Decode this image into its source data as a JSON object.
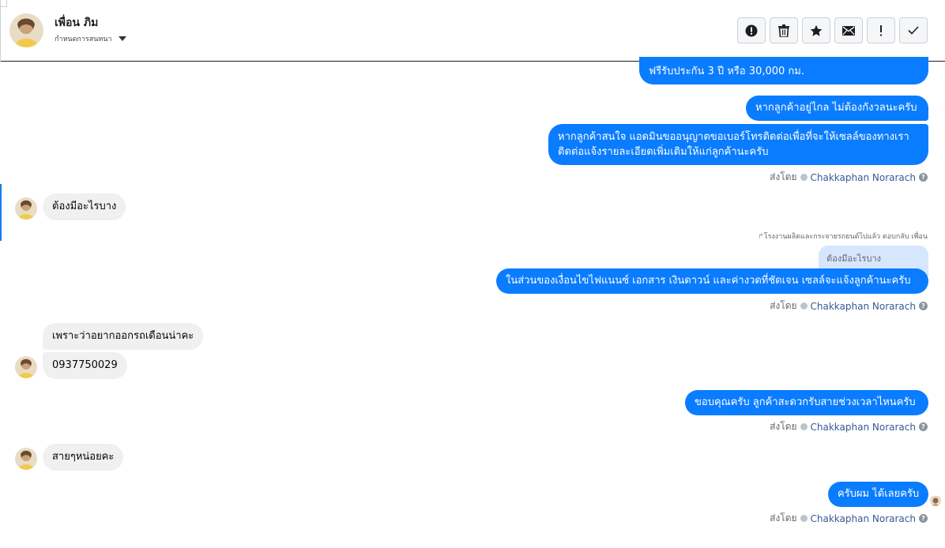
{
  "header": {
    "contact_name": "เพื่อน ภิม",
    "conversation_status": "กำหนดการสนทนา",
    "toolbar": [
      {
        "icon": "alert-circle-icon",
        "label": "spam"
      },
      {
        "icon": "trash-icon",
        "label": "delete"
      },
      {
        "icon": "star-icon",
        "label": "star"
      },
      {
        "icon": "envelope-icon",
        "label": "mark-unread"
      },
      {
        "icon": "exclamation-icon",
        "label": "follow-up"
      },
      {
        "icon": "check-icon",
        "label": "done"
      }
    ]
  },
  "messages": {
    "out1": "ฟรีรับประกัน 3 ปี หรือ 30,000 กม.",
    "out2": "หากลูกค้าอยู่ไกล ไม่ต้องกังวลนะครับ",
    "out3_line1": "หากลูกค้าสนใจ แอดมินขออนุญาตขอเบอร์โทรติดต่อเพื่อที่จะให้เซลล์ของทางเรา",
    "out3_line2": "ติดต่อแจ้งรายละเอียดเพิ่มเติมให้แก่ลูกค้านะครับ",
    "in1": "ต้องมีอะไรบาง",
    "reply_meta": "โรงงานผลิตและกระจายรถยนต์ไปแล้ว ตอบกลับ เพื่อน",
    "reply_quote": "ต้องมีอะไรบาง",
    "out4": "ในส่วนของเงื่อนไขไฟแนนซ์ เอกสาร เงินดาวน์ และค่างวดที่ชัดเจน เซลล์จะแจ้งลูกค้านะครับ",
    "in2": "เพราะว่าอยากออกรถเดือนน่าคะ",
    "in3": "0937750029",
    "out5": "ขอบคุณครับ ลูกค้าสะดวกรับสายช่วงเวลาไหนครับ",
    "in4": "สายๆหน่อยคะ",
    "out6": "ครับผม ได้เลยครับ"
  },
  "sent_by": {
    "prefix": "ส่งโดย",
    "agent": "Chakkaphan Norarach",
    "help": "?"
  },
  "colors": {
    "outgoing_bubble": "#0a7cff",
    "incoming_bubble": "#f0f0f0",
    "reply_quote_bg": "#d6e6fd",
    "agent_link": "#385898"
  }
}
